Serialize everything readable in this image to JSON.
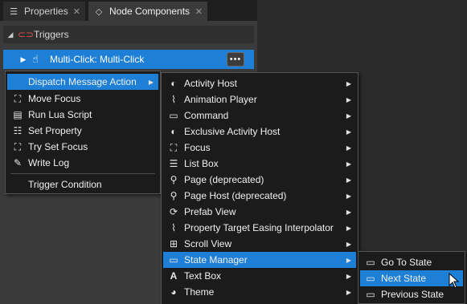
{
  "tabs": [
    {
      "label": "Properties",
      "icon": "list-icon",
      "close": "✕"
    },
    {
      "label": "Node Components",
      "icon": "components-icon",
      "close": "✕"
    }
  ],
  "triggers": {
    "label": "Triggers",
    "expand": "◢",
    "icon": "trigger-icon"
  },
  "trigger_item": {
    "label": "Multi-Click: Multi-Click",
    "expand": "▶",
    "icon": "multi-click-icon",
    "more": "•••"
  },
  "action_menu": {
    "items": [
      {
        "label": "Dispatch Message Action",
        "icon": "",
        "submenu": true,
        "selected": true
      },
      {
        "label": "Move Focus",
        "icon": "focus-icon",
        "submenu": false
      },
      {
        "label": "Run Lua Script",
        "icon": "script-icon",
        "submenu": false
      },
      {
        "label": "Set Property",
        "icon": "property-icon",
        "submenu": false
      },
      {
        "label": "Try Set Focus",
        "icon": "focus-icon",
        "submenu": false
      },
      {
        "label": "Write Log",
        "icon": "log-icon",
        "submenu": false
      }
    ],
    "footer": "Trigger Condition"
  },
  "message_menu": {
    "items": [
      {
        "label": "Activity Host",
        "icon": "activity-host-icon"
      },
      {
        "label": "Animation Player",
        "icon": "animation-icon"
      },
      {
        "label": "Command",
        "icon": "command-icon"
      },
      {
        "label": "Exclusive Activity Host",
        "icon": "activity-host-icon"
      },
      {
        "label": "Focus",
        "icon": "focus-icon"
      },
      {
        "label": "List Box",
        "icon": "list-box-icon"
      },
      {
        "label": "Page (deprecated)",
        "icon": "page-icon"
      },
      {
        "label": "Page Host (deprecated)",
        "icon": "page-host-icon"
      },
      {
        "label": "Prefab View",
        "icon": "prefab-icon"
      },
      {
        "label": "Property Target Easing Interpolator",
        "icon": "interpolator-icon"
      },
      {
        "label": "Scroll View",
        "icon": "scroll-view-icon"
      },
      {
        "label": "State Manager",
        "icon": "state-manager-icon",
        "selected": true
      },
      {
        "label": "Text Box",
        "icon": "text-box-icon"
      },
      {
        "label": "Theme",
        "icon": "theme-icon"
      }
    ]
  },
  "state_menu": {
    "items": [
      {
        "label": "Go To State",
        "icon": "state-icon"
      },
      {
        "label": "Next State",
        "icon": "state-icon",
        "selected": true
      },
      {
        "label": "Previous State",
        "icon": "state-icon"
      }
    ]
  },
  "colors": {
    "accent": "#1e7fd6",
    "menu_bg": "#1b1b1b",
    "panel_bg": "#3a3a3a"
  }
}
